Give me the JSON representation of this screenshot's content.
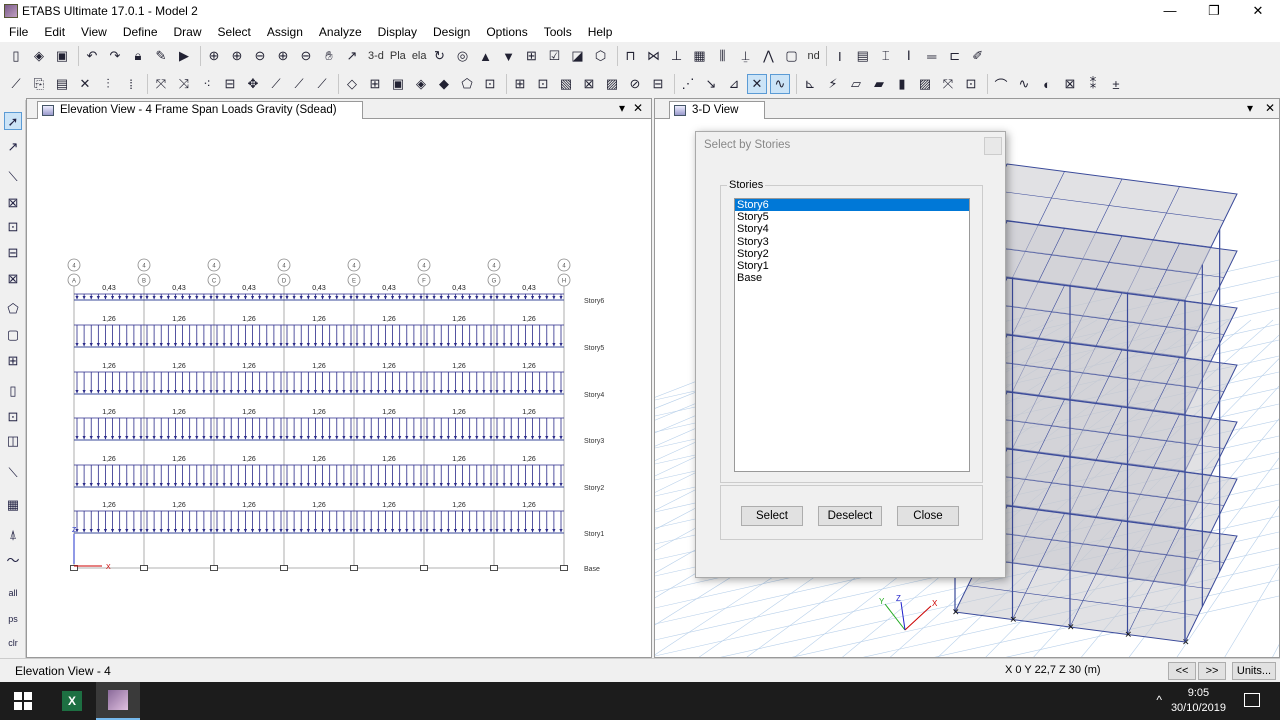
{
  "window": {
    "title": "ETABS Ultimate 17.0.1 - Model 2",
    "controls": [
      "—",
      "❐",
      "✕"
    ]
  },
  "menu": [
    "File",
    "Edit",
    "View",
    "Define",
    "Draw",
    "Select",
    "Assign",
    "Analyze",
    "Display",
    "Design",
    "Options",
    "Tools",
    "Help"
  ],
  "toolbar": {
    "view_3d_label": "3-d",
    "plan_label": "Pla",
    "elev_label": "ela",
    "nd_label": "nd"
  },
  "left_view": {
    "tab_title": "Elevation View - 4  Frame Span Loads Gravity (Sdead)",
    "close_label": "✕",
    "dropdown_label": "▾",
    "grid_bubbles": [
      {
        "num": "4",
        "letter": "A"
      },
      {
        "num": "4",
        "letter": "B"
      },
      {
        "num": "4",
        "letter": "C"
      },
      {
        "num": "4",
        "letter": "D"
      },
      {
        "num": "4",
        "letter": "E"
      },
      {
        "num": "4",
        "letter": "F"
      },
      {
        "num": "4",
        "letter": "G"
      },
      {
        "num": "4",
        "letter": "H"
      }
    ],
    "stories": [
      {
        "name": "Story6",
        "load": "0,43"
      },
      {
        "name": "Story5",
        "load": "1,26"
      },
      {
        "name": "Story4",
        "load": "1,26"
      },
      {
        "name": "Story3",
        "load": "1,26"
      },
      {
        "name": "Story2",
        "load": "1,26"
      },
      {
        "name": "Story1",
        "load": "1,26"
      }
    ],
    "base_label": "Base",
    "axis_x_label": "X",
    "axis_z_label": "Z"
  },
  "right_view": {
    "tab_title": "3-D View",
    "close_label": "✕",
    "dropdown_label": "▾",
    "axis_labels": {
      "x": "X",
      "y": "Y",
      "z": "Z"
    }
  },
  "dialog": {
    "title": "Select by Stories",
    "group_label": "Stories",
    "items": [
      "Story6",
      "Story5",
      "Story4",
      "Story3",
      "Story2",
      "Story1",
      "Base"
    ],
    "selected": "Story6",
    "buttons": {
      "select": "Select",
      "deselect": "Deselect",
      "close": "Close"
    }
  },
  "status": {
    "left_text": "Elevation View - 4",
    "coords": "X 0  Y 22,7  Z 30 (m)",
    "prev_label": "<<",
    "next_label": ">>",
    "units_label": "Units..."
  },
  "taskbar": {
    "excel_label": "X",
    "time": "9:05",
    "date": "30/10/2019",
    "tray_arrow": "^"
  },
  "colors": {
    "frame_blue": "#3a4a9a",
    "load_arrow": "#2a2a8a",
    "selection": "#0078d7",
    "grid_line": "#b8d0ea"
  }
}
